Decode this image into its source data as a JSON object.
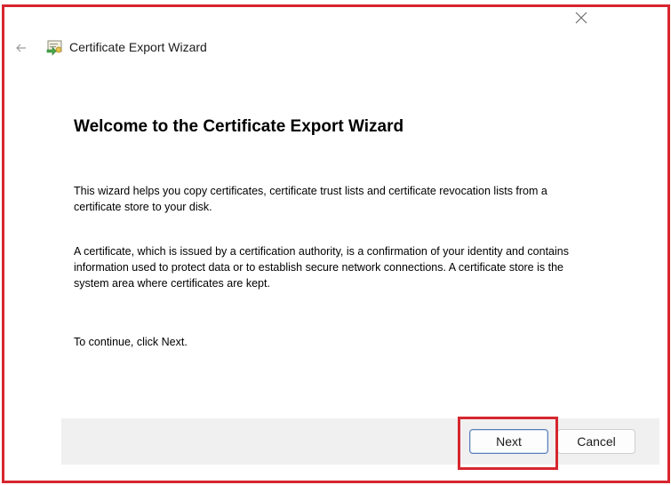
{
  "window": {
    "title": "Certificate Export Wizard",
    "close_icon": "close-icon",
    "back_icon": "back-arrow-icon",
    "app_icon": "certificate-icon"
  },
  "content": {
    "heading": "Welcome to the Certificate Export Wizard",
    "paragraph1": "This wizard helps you copy certificates, certificate trust lists and certificate revocation lists from a certificate store to your disk.",
    "paragraph2": "A certificate, which is issued by a certification authority, is a confirmation of your identity and contains information used to protect data or to establish secure network connections. A certificate store is the system area where certificates are kept.",
    "paragraph3": "To continue, click Next."
  },
  "footer": {
    "next_label": "Next",
    "cancel_label": "Cancel"
  },
  "colors": {
    "highlight": "#d7262f",
    "footer_bg": "#f0f0f0",
    "next_border": "#5a7fb8"
  }
}
